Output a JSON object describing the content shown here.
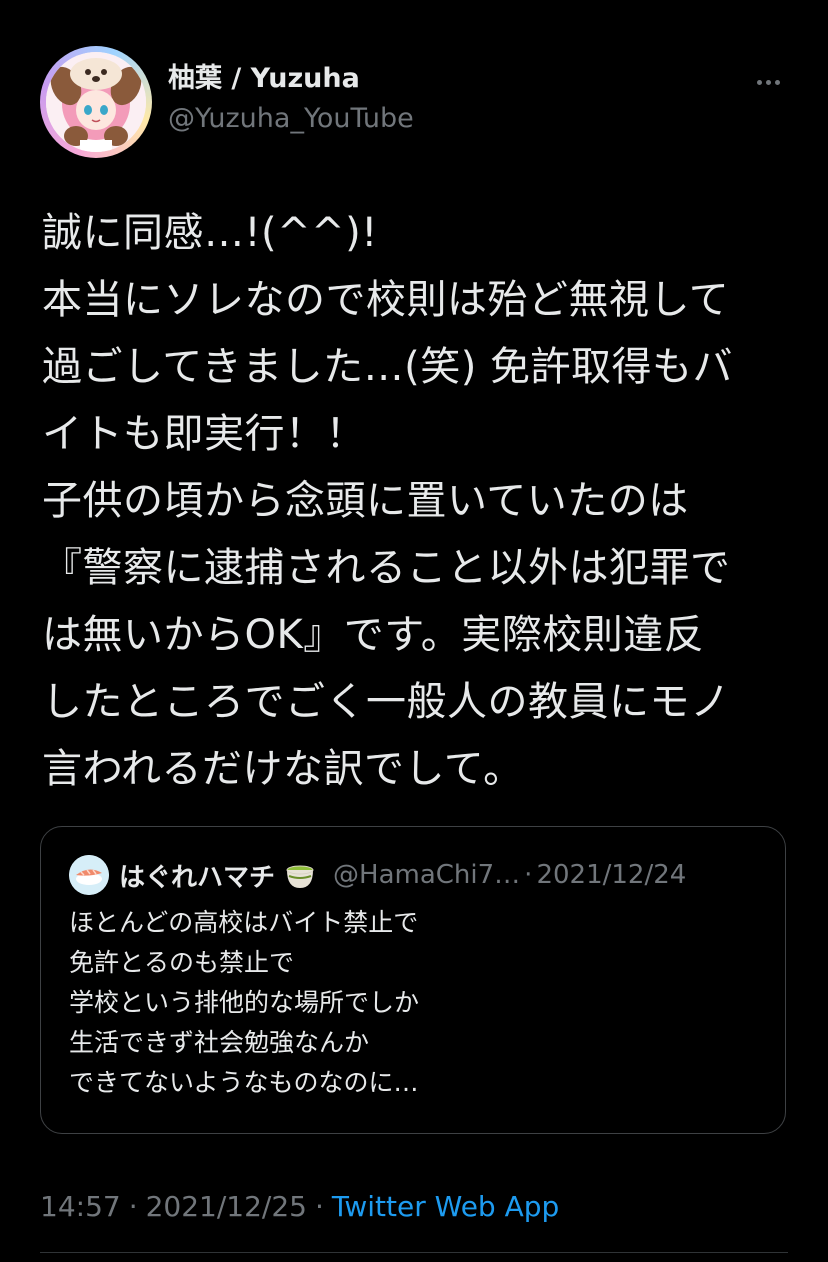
{
  "author": {
    "display_name": "柚葉 / Yuzuha",
    "handle": "@Yuzuha_YouTube",
    "avatar_icon": "anime-avatar-icon"
  },
  "tweet": {
    "text": "誠に同感…!(^^)!\n本当にソレなので校則は殆ど無視して\n過ごしてきました…(笑) 免許取得もバ\nイトも即実行！！\n子供の頃から念頭に置いていたのは\n『警察に逮捕されること以外は犯罪で\nは無いからOK』です。実際校則違反\nしたところでごく一般人の教員にモノ\n言われるだけな訳でして。"
  },
  "quoted_tweet": {
    "author_name": "はぐれハマチ",
    "name_emoji": "green-tea-icon",
    "handle": "@HamaChi7…",
    "separator": "·",
    "date": "2021/12/24",
    "avatar_icon": "sushi-avatar-icon",
    "text": "ほとんどの高校はバイト禁止で\n免許とるのも禁止で\n学校という排他的な場所でしか\n生活できず社会勉強なんか\nできてないようなものなのに…"
  },
  "meta": {
    "time": "14:57",
    "separator": "·",
    "date": "2021/12/25",
    "source": "Twitter Web App"
  },
  "colors": {
    "background": "#000000",
    "text": "#e7e9ea",
    "secondary": "#71767b",
    "link": "#1d9bf0",
    "border": "#3e4144"
  }
}
